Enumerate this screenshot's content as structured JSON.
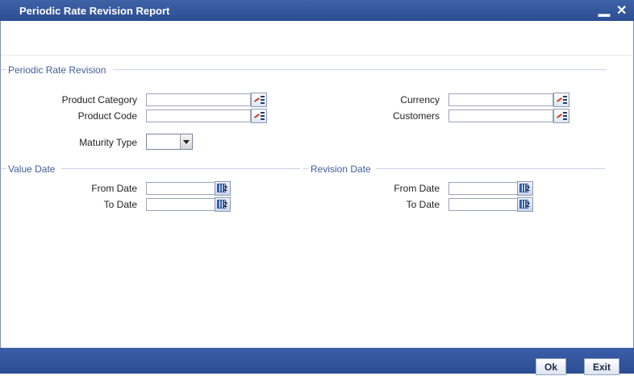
{
  "window": {
    "title": "Periodic Rate Revision Report",
    "minimize_glyph": "▁",
    "close_glyph": "✕"
  },
  "sections": {
    "periodic": {
      "title": "Periodic Rate Revision"
    },
    "value_date": {
      "title": "Value Date"
    },
    "revision_date": {
      "title": "Revision Date"
    }
  },
  "fields": {
    "product_category": {
      "label": "Product Category",
      "value": ""
    },
    "product_code": {
      "label": "Product Code",
      "value": ""
    },
    "currency": {
      "label": "Currency",
      "value": ""
    },
    "customers": {
      "label": "Customers",
      "value": ""
    },
    "maturity_type": {
      "label": "Maturity Type",
      "value": ""
    },
    "value_from": {
      "label": "From Date",
      "value": ""
    },
    "value_to": {
      "label": "To Date",
      "value": ""
    },
    "revision_from": {
      "label": "From Date",
      "value": ""
    },
    "revision_to": {
      "label": "To Date",
      "value": ""
    }
  },
  "footer": {
    "ok_label": "Ok",
    "exit_label": "Exit"
  },
  "icons": {
    "lov": "list-of-values-icon",
    "calendar": "calendar-icon"
  },
  "colors": {
    "titlebar": "#2c4d92",
    "section_title": "#3f5f98",
    "lov_arrow": "#d03a1f"
  }
}
